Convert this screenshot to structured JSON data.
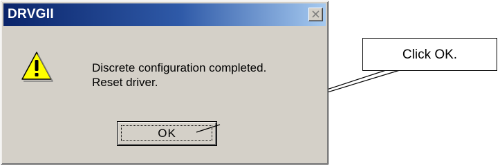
{
  "dialog": {
    "title": "DRVGII",
    "close_icon": "close-x-icon",
    "icon": "warning-exclamation-icon",
    "message_lines": [
      "Discrete configuration completed.",
      "Reset driver."
    ],
    "ok_label": "OK"
  },
  "callout": {
    "text": "Click OK."
  },
  "colors": {
    "title_bar_start": "#0a246a",
    "title_bar_end": "#a6caf0",
    "dialog_face": "#d4d0c8",
    "warning_fill": "#ffff00"
  }
}
